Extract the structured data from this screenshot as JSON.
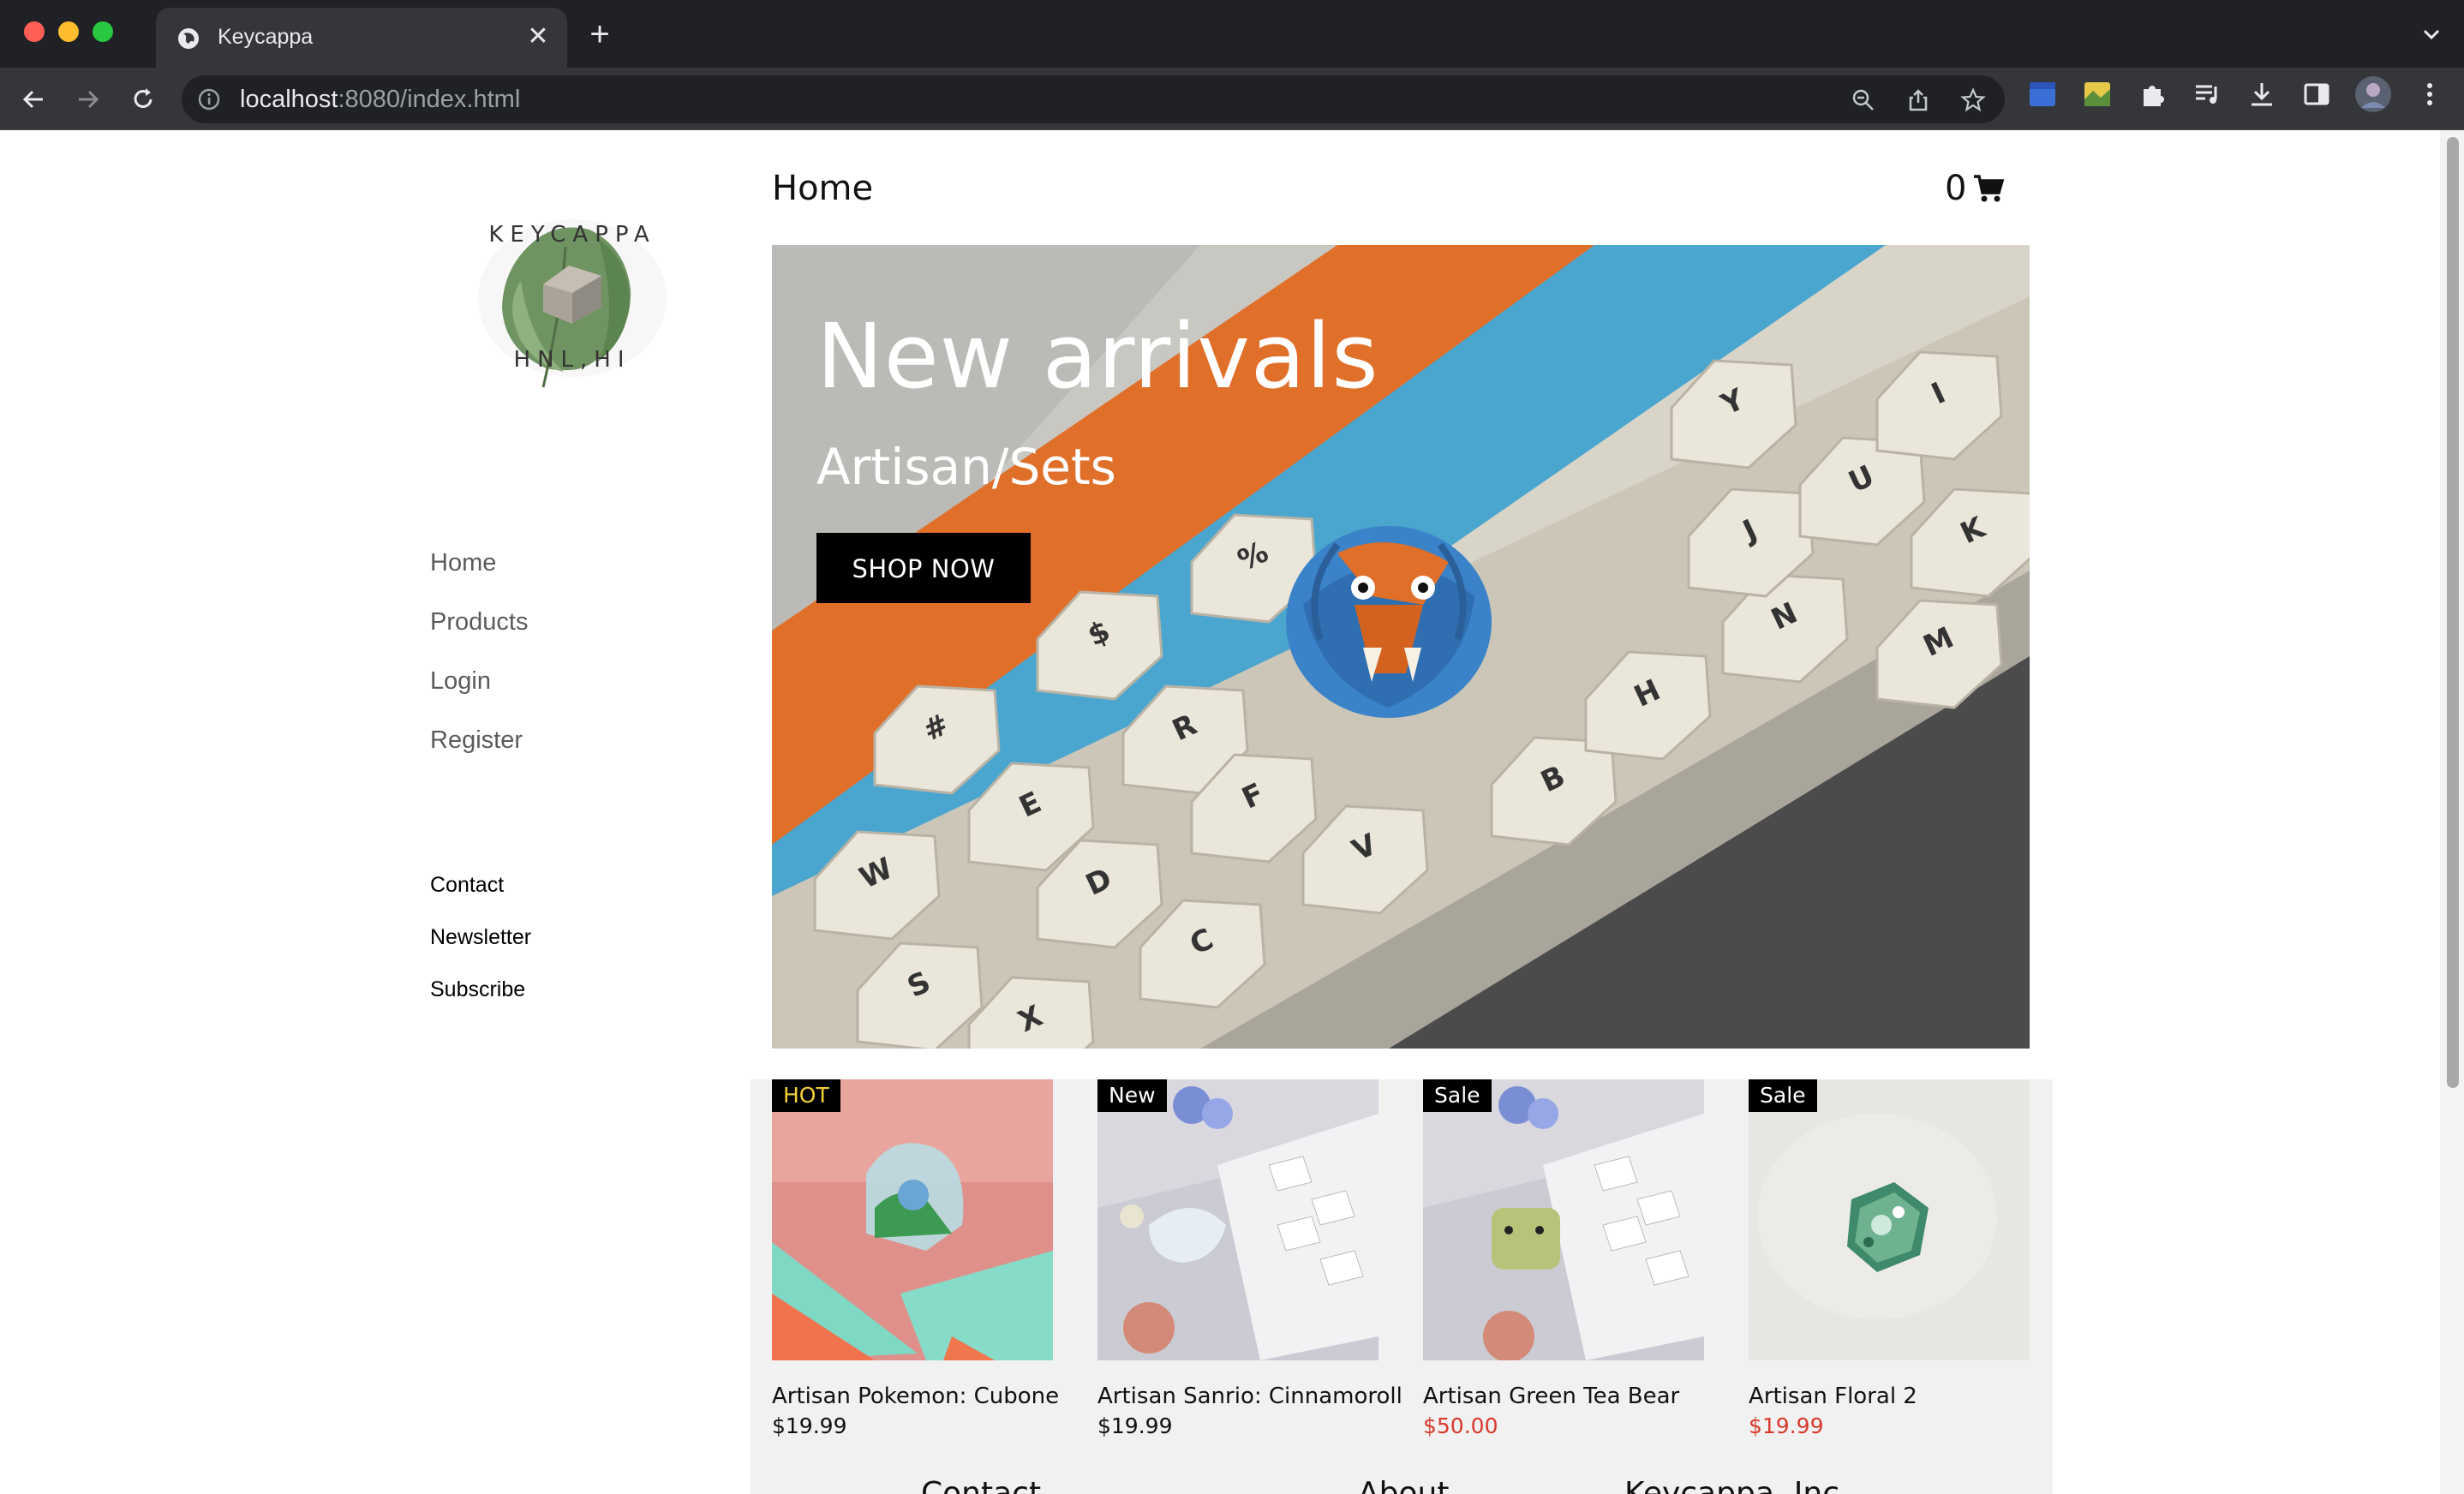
{
  "browser": {
    "tab_title": "Keycappa",
    "tab_close": "✕",
    "new_tab": "+",
    "url_host": "localhost",
    "url_path": ":8080/index.html"
  },
  "logo": {
    "top_text": "KEYCAPPA",
    "bottom_text": "HNL,HI"
  },
  "sidebar": {
    "nav": [
      {
        "label": "Home"
      },
      {
        "label": "Products"
      },
      {
        "label": "Login"
      },
      {
        "label": "Register"
      }
    ],
    "footer_links": [
      {
        "label": "Contact"
      },
      {
        "label": "Newsletter"
      },
      {
        "label": "Subscribe"
      }
    ]
  },
  "header": {
    "title": "Home",
    "cart_count": "0"
  },
  "hero": {
    "title": "New arrivals",
    "subtitle": "Artisan/Sets",
    "button": "SHOP NOW",
    "key_letters": [
      "W",
      "E",
      "R",
      "D",
      "F",
      "S",
      "C",
      "V",
      "X",
      "B",
      "H",
      "N",
      "J",
      "U",
      "Y",
      "I",
      "K",
      "M",
      "#",
      "$",
      "%"
    ]
  },
  "products": [
    {
      "badge": "HOT",
      "name": "Artisan Pokemon: Cubone",
      "price": "$19.99",
      "on_sale": false
    },
    {
      "badge": "New",
      "name": "Artisan Sanrio: Cinnamoroll",
      "price": "$19.99",
      "on_sale": false
    },
    {
      "badge": "Sale",
      "name": "Artisan Green Tea Bear",
      "price": "$50.00",
      "on_sale": true
    },
    {
      "badge": "Sale",
      "name": "Artisan Floral 2",
      "price": "$19.99",
      "on_sale": true
    }
  ],
  "footer_peek": [
    "Contact",
    "About",
    "Keycappa, Inc"
  ],
  "colors": {
    "accent": "#000000",
    "sale_price": "#d9392b",
    "hot_badge_text": "#f3d035"
  }
}
